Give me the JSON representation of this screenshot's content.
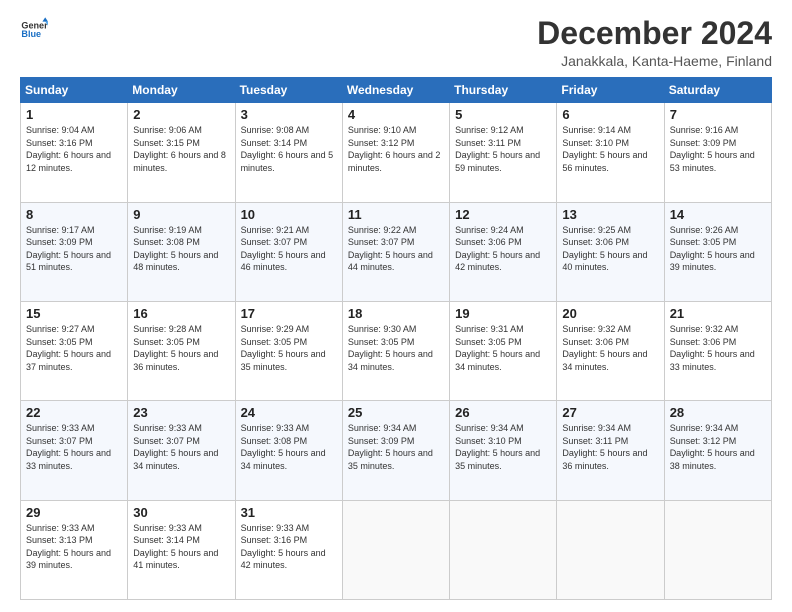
{
  "logo": {
    "line1": "General",
    "line2": "Blue"
  },
  "title": "December 2024",
  "subtitle": "Janakkala, Kanta-Haeme, Finland",
  "header_days": [
    "Sunday",
    "Monday",
    "Tuesday",
    "Wednesday",
    "Thursday",
    "Friday",
    "Saturday"
  ],
  "weeks": [
    [
      {
        "day": "1",
        "sunrise": "Sunrise: 9:04 AM",
        "sunset": "Sunset: 3:16 PM",
        "daylight": "Daylight: 6 hours and 12 minutes."
      },
      {
        "day": "2",
        "sunrise": "Sunrise: 9:06 AM",
        "sunset": "Sunset: 3:15 PM",
        "daylight": "Daylight: 6 hours and 8 minutes."
      },
      {
        "day": "3",
        "sunrise": "Sunrise: 9:08 AM",
        "sunset": "Sunset: 3:14 PM",
        "daylight": "Daylight: 6 hours and 5 minutes."
      },
      {
        "day": "4",
        "sunrise": "Sunrise: 9:10 AM",
        "sunset": "Sunset: 3:12 PM",
        "daylight": "Daylight: 6 hours and 2 minutes."
      },
      {
        "day": "5",
        "sunrise": "Sunrise: 9:12 AM",
        "sunset": "Sunset: 3:11 PM",
        "daylight": "Daylight: 5 hours and 59 minutes."
      },
      {
        "day": "6",
        "sunrise": "Sunrise: 9:14 AM",
        "sunset": "Sunset: 3:10 PM",
        "daylight": "Daylight: 5 hours and 56 minutes."
      },
      {
        "day": "7",
        "sunrise": "Sunrise: 9:16 AM",
        "sunset": "Sunset: 3:09 PM",
        "daylight": "Daylight: 5 hours and 53 minutes."
      }
    ],
    [
      {
        "day": "8",
        "sunrise": "Sunrise: 9:17 AM",
        "sunset": "Sunset: 3:09 PM",
        "daylight": "Daylight: 5 hours and 51 minutes."
      },
      {
        "day": "9",
        "sunrise": "Sunrise: 9:19 AM",
        "sunset": "Sunset: 3:08 PM",
        "daylight": "Daylight: 5 hours and 48 minutes."
      },
      {
        "day": "10",
        "sunrise": "Sunrise: 9:21 AM",
        "sunset": "Sunset: 3:07 PM",
        "daylight": "Daylight: 5 hours and 46 minutes."
      },
      {
        "day": "11",
        "sunrise": "Sunrise: 9:22 AM",
        "sunset": "Sunset: 3:07 PM",
        "daylight": "Daylight: 5 hours and 44 minutes."
      },
      {
        "day": "12",
        "sunrise": "Sunrise: 9:24 AM",
        "sunset": "Sunset: 3:06 PM",
        "daylight": "Daylight: 5 hours and 42 minutes."
      },
      {
        "day": "13",
        "sunrise": "Sunrise: 9:25 AM",
        "sunset": "Sunset: 3:06 PM",
        "daylight": "Daylight: 5 hours and 40 minutes."
      },
      {
        "day": "14",
        "sunrise": "Sunrise: 9:26 AM",
        "sunset": "Sunset: 3:05 PM",
        "daylight": "Daylight: 5 hours and 39 minutes."
      }
    ],
    [
      {
        "day": "15",
        "sunrise": "Sunrise: 9:27 AM",
        "sunset": "Sunset: 3:05 PM",
        "daylight": "Daylight: 5 hours and 37 minutes."
      },
      {
        "day": "16",
        "sunrise": "Sunrise: 9:28 AM",
        "sunset": "Sunset: 3:05 PM",
        "daylight": "Daylight: 5 hours and 36 minutes."
      },
      {
        "day": "17",
        "sunrise": "Sunrise: 9:29 AM",
        "sunset": "Sunset: 3:05 PM",
        "daylight": "Daylight: 5 hours and 35 minutes."
      },
      {
        "day": "18",
        "sunrise": "Sunrise: 9:30 AM",
        "sunset": "Sunset: 3:05 PM",
        "daylight": "Daylight: 5 hours and 34 minutes."
      },
      {
        "day": "19",
        "sunrise": "Sunrise: 9:31 AM",
        "sunset": "Sunset: 3:05 PM",
        "daylight": "Daylight: 5 hours and 34 minutes."
      },
      {
        "day": "20",
        "sunrise": "Sunrise: 9:32 AM",
        "sunset": "Sunset: 3:06 PM",
        "daylight": "Daylight: 5 hours and 34 minutes."
      },
      {
        "day": "21",
        "sunrise": "Sunrise: 9:32 AM",
        "sunset": "Sunset: 3:06 PM",
        "daylight": "Daylight: 5 hours and 33 minutes."
      }
    ],
    [
      {
        "day": "22",
        "sunrise": "Sunrise: 9:33 AM",
        "sunset": "Sunset: 3:07 PM",
        "daylight": "Daylight: 5 hours and 33 minutes."
      },
      {
        "day": "23",
        "sunrise": "Sunrise: 9:33 AM",
        "sunset": "Sunset: 3:07 PM",
        "daylight": "Daylight: 5 hours and 34 minutes."
      },
      {
        "day": "24",
        "sunrise": "Sunrise: 9:33 AM",
        "sunset": "Sunset: 3:08 PM",
        "daylight": "Daylight: 5 hours and 34 minutes."
      },
      {
        "day": "25",
        "sunrise": "Sunrise: 9:34 AM",
        "sunset": "Sunset: 3:09 PM",
        "daylight": "Daylight: 5 hours and 35 minutes."
      },
      {
        "day": "26",
        "sunrise": "Sunrise: 9:34 AM",
        "sunset": "Sunset: 3:10 PM",
        "daylight": "Daylight: 5 hours and 35 minutes."
      },
      {
        "day": "27",
        "sunrise": "Sunrise: 9:34 AM",
        "sunset": "Sunset: 3:11 PM",
        "daylight": "Daylight: 5 hours and 36 minutes."
      },
      {
        "day": "28",
        "sunrise": "Sunrise: 9:34 AM",
        "sunset": "Sunset: 3:12 PM",
        "daylight": "Daylight: 5 hours and 38 minutes."
      }
    ],
    [
      {
        "day": "29",
        "sunrise": "Sunrise: 9:33 AM",
        "sunset": "Sunset: 3:13 PM",
        "daylight": "Daylight: 5 hours and 39 minutes."
      },
      {
        "day": "30",
        "sunrise": "Sunrise: 9:33 AM",
        "sunset": "Sunset: 3:14 PM",
        "daylight": "Daylight: 5 hours and 41 minutes."
      },
      {
        "day": "31",
        "sunrise": "Sunrise: 9:33 AM",
        "sunset": "Sunset: 3:16 PM",
        "daylight": "Daylight: 5 hours and 42 minutes."
      },
      null,
      null,
      null,
      null
    ]
  ]
}
